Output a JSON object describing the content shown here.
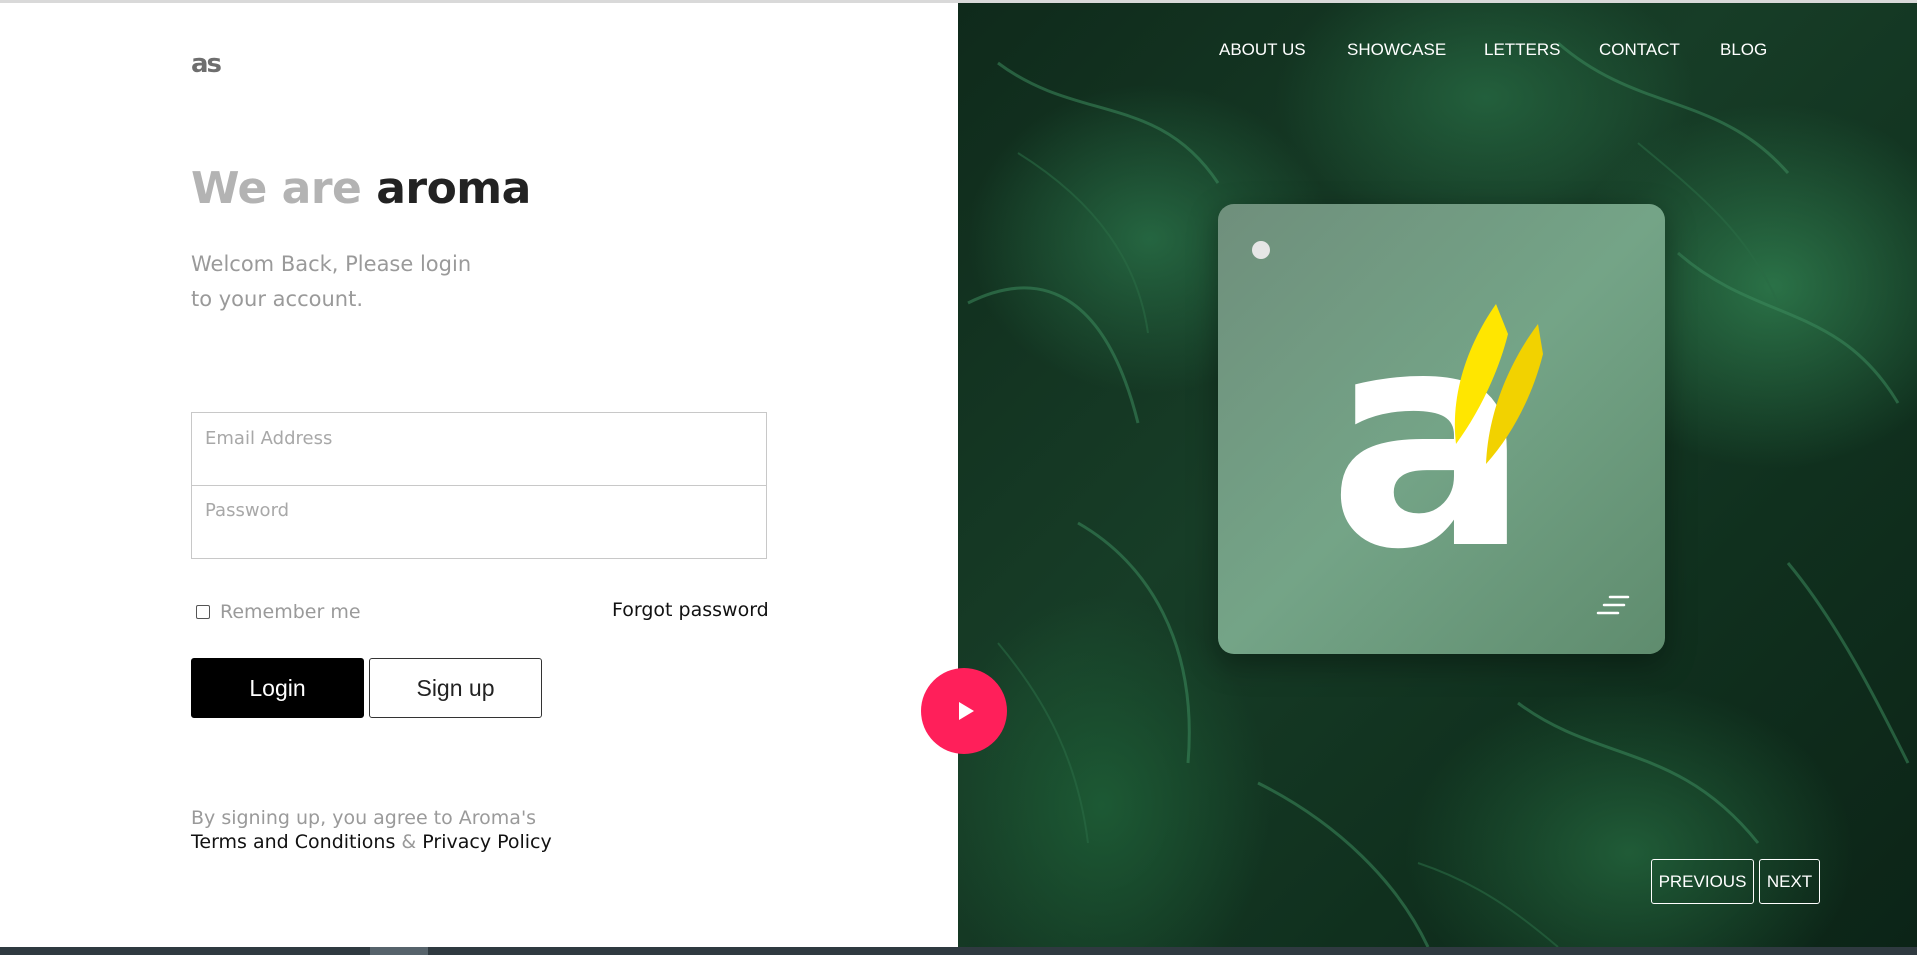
{
  "brand": {
    "logo_text": "as"
  },
  "login": {
    "headline_light": "We are",
    "headline_dark": "aroma",
    "subtitle_line1": "Welcom Back, Please login",
    "subtitle_line2": "to your account.",
    "email_placeholder": "Email Address",
    "password_placeholder": "Password",
    "remember_label": "Remember me",
    "remember_checked": false,
    "forgot_label": "Forgot password",
    "login_label": "Login",
    "signup_label": "Sign up",
    "terms_prefix": "By signing up, you agree to Aroma's",
    "terms_link": "Terms and Conditions",
    "terms_amp": "&",
    "privacy_link": "Privacy Policy"
  },
  "nav": {
    "items": [
      {
        "label": "ABOUT US"
      },
      {
        "label": "SHOWCASE"
      },
      {
        "label": "LETTERS"
      },
      {
        "label": "CONTACT"
      },
      {
        "label": "BLOG"
      }
    ]
  },
  "card": {
    "mark_letter": "a"
  },
  "pager": {
    "previous_label": "PREVIOUS",
    "next_label": "NEXT"
  },
  "colors": {
    "accent": "#ff1f5a",
    "button_dark": "#000000",
    "muted_text": "#9a9a9a",
    "leaf_green": "#1f5a38",
    "card_green": "#74a487",
    "logo_yellow": "#ffe600"
  }
}
